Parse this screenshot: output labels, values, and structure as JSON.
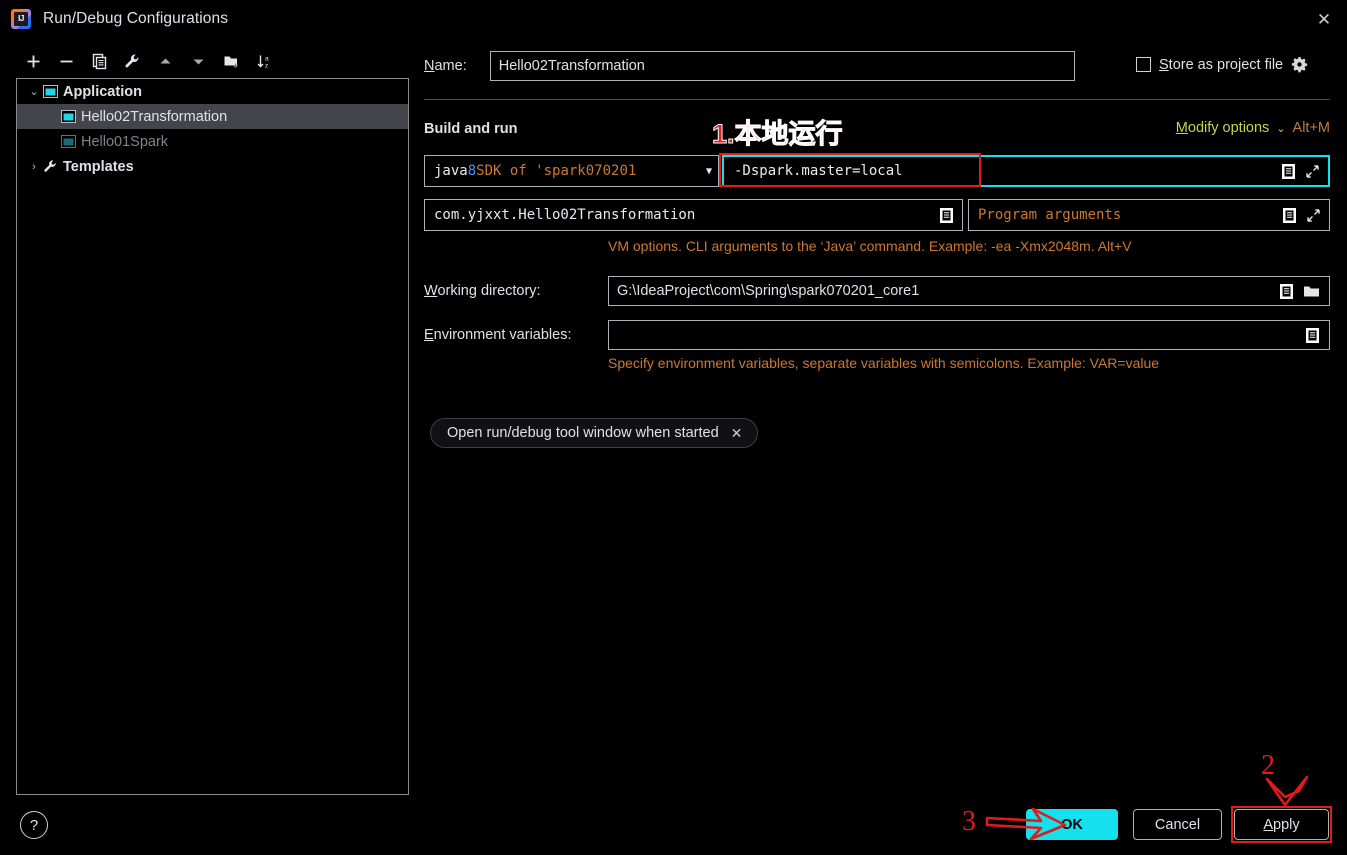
{
  "window": {
    "title": "Run/Debug Configurations",
    "app_icon": "intellij-idea-icon",
    "close_label": "✕"
  },
  "toolbar": {
    "buttons": [
      {
        "name": "add-configuration-button",
        "icon": "plus-icon"
      },
      {
        "name": "remove-configuration-button",
        "icon": "minus-icon"
      },
      {
        "name": "copy-configuration-button",
        "icon": "copy-icon"
      },
      {
        "name": "edit-templates-button",
        "icon": "wrench-icon"
      },
      {
        "name": "move-up-button",
        "icon": "arrow-up-icon"
      },
      {
        "name": "move-down-button",
        "icon": "arrow-down-icon"
      },
      {
        "name": "new-folder-button",
        "icon": "folder-add-icon"
      },
      {
        "name": "sort-alphabetically-button",
        "icon": "sort-az-icon"
      }
    ]
  },
  "tree": {
    "items": [
      {
        "label": "Application",
        "icon": "application-icon",
        "expand": "⌄",
        "level": 0,
        "bold": true,
        "selected": false,
        "dim": false
      },
      {
        "label": "Hello02Transformation",
        "icon": "application-icon",
        "expand": "",
        "level": 1,
        "bold": false,
        "selected": true,
        "dim": false
      },
      {
        "label": "Hello01Spark",
        "icon": "application-icon",
        "expand": "",
        "level": 1,
        "bold": false,
        "selected": false,
        "dim": true
      },
      {
        "label": "Templates",
        "icon": "wrench-icon",
        "expand": "›",
        "level": 0,
        "bold": true,
        "selected": false,
        "dim": false
      }
    ]
  },
  "form": {
    "name_label": "N",
    "name_label_rest": "ame:",
    "name_value": "Hello02Transformation",
    "name_placeholder": "",
    "store_as_project_file": {
      "label_accel": "S",
      "label_rest": "tore as project file",
      "checked": false,
      "gear_icon": "gear-icon"
    },
    "section_title": "Build and run",
    "modify_options": {
      "accel": "M",
      "rest": "odify options",
      "chevron": "⌄",
      "shortcut": "Alt+M"
    },
    "sdk_combo": {
      "part_java": "java ",
      "part_version": "8",
      "part_rest": " SDK of 'spark070201",
      "caret": "▼"
    },
    "vm_options": {
      "value": "-Dspark.master=local",
      "placeholder": "VM options",
      "doc_icon": "document-icon",
      "expand_icon": "expand-icon"
    },
    "main_class": {
      "value": "com.yjxxt.Hello02Transformation",
      "doc_icon": "document-icon"
    },
    "program_arguments": {
      "value": "",
      "placeholder": "Program arguments",
      "doc_icon": "document-icon",
      "expand_icon": "expand-icon"
    },
    "vm_hint": "VM options. CLI arguments to the ‘Java’ command. Example: -ea -Xmx2048m. Alt+V",
    "working_directory": {
      "label_accel": "W",
      "label_rest": "orking directory:",
      "value": "G:\\IdeaProject\\com\\Spring\\spark070201_core1",
      "doc_icon": "document-icon",
      "folder_icon": "folder-icon"
    },
    "environment_variables": {
      "label_accel": "E",
      "label_rest": "nvironment variables:",
      "value": "",
      "doc_icon": "document-icon"
    },
    "env_hint": "Specify environment variables, separate variables with semicolons. Example: VAR=value",
    "chip": {
      "label": "Open run/debug tool window when started",
      "close": "✕"
    }
  },
  "footer": {
    "help_label": "?",
    "ok_label": "OK",
    "cancel_label": "Cancel",
    "apply_accel": "A",
    "apply_rest": "pply"
  },
  "annotations": {
    "step1_text": "1.本地运行",
    "step2_text": "2",
    "step3_text": "3",
    "highlight_color": "#e01b1b",
    "focus_color": "#15e0ee"
  }
}
